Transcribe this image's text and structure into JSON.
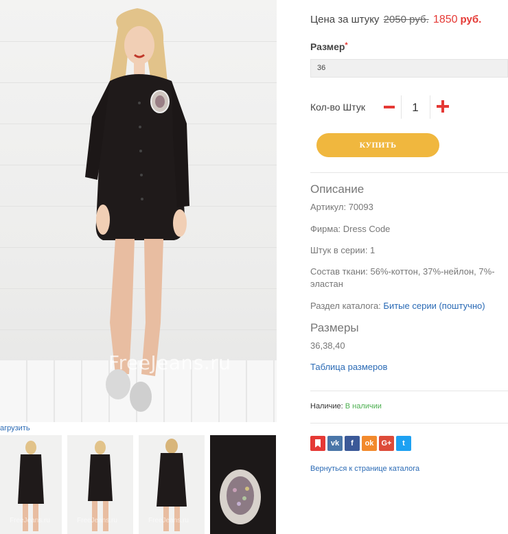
{
  "gallery": {
    "watermark": "FreeJeans.ru",
    "zoom_link": "агрузить",
    "thumb_watermark": "FreeJeans.ru"
  },
  "product": {
    "price_label": "Цена за штуку",
    "price_old": "2050 руб.",
    "price_new": "1850",
    "price_currency": "руб.",
    "size_label": "Размер",
    "size_required_mark": "*",
    "size_value": "36",
    "qty_label": "Кол-во Штук",
    "qty_value": "1",
    "buy_label": "КУПИТЬ"
  },
  "description": {
    "title": "Описание",
    "article": "Артикул: 70093",
    "brand": "Фирма: Dress Code",
    "per_series": "Штук в серии: 1",
    "composition": "Состав ткани: 56%-коттон, 37%-нейлон, 7%-эластан",
    "catalog_prefix": "Раздел каталога:",
    "catalog_link": "Битые серии (поштучно)"
  },
  "sizes": {
    "title": "Размеры",
    "list": "36,38,40",
    "table_link": "Таблица размеров"
  },
  "availability": {
    "label": "Наличие:",
    "value": "В наличии"
  },
  "share": [
    {
      "name": "bookmark-icon",
      "glyph": "",
      "color": "#e53935"
    },
    {
      "name": "vk-icon",
      "glyph": "vk",
      "color": "#4a76a8"
    },
    {
      "name": "facebook-icon",
      "glyph": "f",
      "color": "#3b5998"
    },
    {
      "name": "odnoklassniki-icon",
      "glyph": "ok",
      "color": "#f2892c"
    },
    {
      "name": "google-plus-icon",
      "glyph": "G+",
      "color": "#dd4b39"
    },
    {
      "name": "twitter-icon",
      "glyph": "t",
      "color": "#1da1f2"
    }
  ],
  "back_link": "Вернуться к странице каталога",
  "colors": {
    "accent_red": "#e53935",
    "buy_button": "#f0b73e",
    "link": "#2a6ab5",
    "in_stock": "#4caf50"
  }
}
